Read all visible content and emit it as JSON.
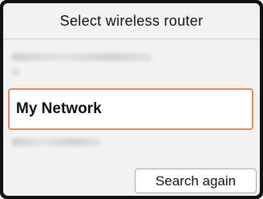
{
  "header": {
    "title": "Select wireless router"
  },
  "network_list": {
    "selected_network": "My Network"
  },
  "actions": {
    "search_again_label": "Search again"
  },
  "colors": {
    "selection_border": "#e08a5c",
    "bezel": "#111111",
    "panel_background": "#f2f2f2"
  }
}
